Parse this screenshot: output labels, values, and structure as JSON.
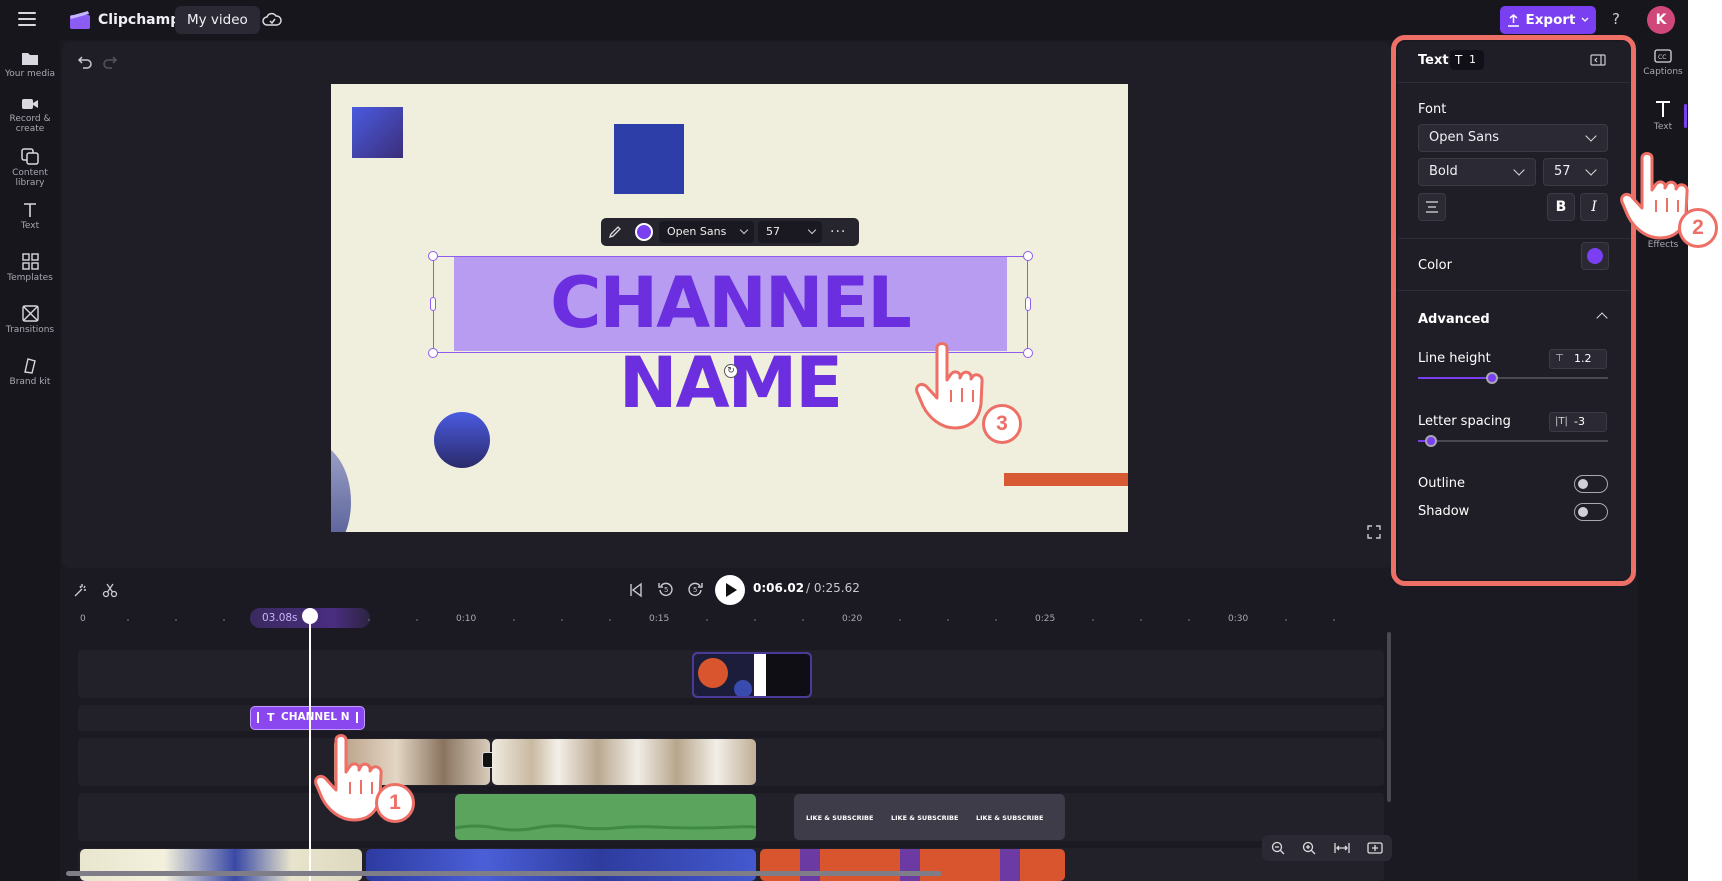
{
  "app": {
    "name": "Clipchamp",
    "project_tab": "My video",
    "export_label": "Export",
    "help": "?",
    "avatar_initial": "K"
  },
  "left_nav": [
    {
      "label": "Your media",
      "icon": "folder-icon"
    },
    {
      "label": "Record & create",
      "icon": "camera-icon"
    },
    {
      "label": "Content library",
      "icon": "library-icon"
    },
    {
      "label": "Text",
      "icon": "text-icon"
    },
    {
      "label": "Templates",
      "icon": "templates-icon"
    },
    {
      "label": "Transitions",
      "icon": "transitions-icon"
    },
    {
      "label": "Brand kit",
      "icon": "brand-kit-icon"
    }
  ],
  "canvas": {
    "text": "CHANNEL NAME",
    "text_color": "#6c2fe0",
    "background": "#f0eedc",
    "toolbar": {
      "font": "Open Sans",
      "size": "57",
      "color": "#7a3ff0",
      "more": "···"
    }
  },
  "playback": {
    "current_time": "0:06.02",
    "total_time": "/ 0:25.62",
    "skip_back_label": "5",
    "skip_fwd_label": "5"
  },
  "timeline": {
    "playhead_time": "03.08s",
    "ruler_labels": [
      "0",
      "0:10",
      "0:15",
      "0:20",
      "0:25",
      "0:30"
    ],
    "text_clip_label": "CHANNEL N",
    "like_subscribe": [
      "LIKE & SUBSCRIBE",
      "LIKE & SUBSCRIBE",
      "LIKE & SUBSCRIBE"
    ]
  },
  "panel": {
    "title": "Text",
    "count": "1",
    "font_label": "Font",
    "font_value": "Open Sans",
    "weight_value": "Bold",
    "size_value": "57",
    "bold_label": "B",
    "italic_label": "I",
    "color_label": "Color",
    "color_value": "#7a3ff0",
    "advanced_label": "Advanced",
    "line_height_label": "Line height",
    "line_height_value": "1.2",
    "line_height_fraction": 0.39,
    "letter_spacing_label": "Letter spacing",
    "letter_spacing_value": "-3",
    "letter_spacing_fraction": 0.07,
    "outline_label": "Outline",
    "outline_on": false,
    "shadow_label": "Shadow",
    "shadow_on": false
  },
  "right_rail": [
    {
      "label": "Captions",
      "icon": "captions-icon"
    },
    {
      "label": "Text",
      "icon": "text-icon"
    },
    {
      "label": "Effects",
      "icon": "effects-icon"
    }
  ],
  "callouts": [
    "1",
    "2",
    "3"
  ],
  "colors": {
    "accent": "#7b3ff2",
    "highlight_outline": "#ed6f66"
  }
}
